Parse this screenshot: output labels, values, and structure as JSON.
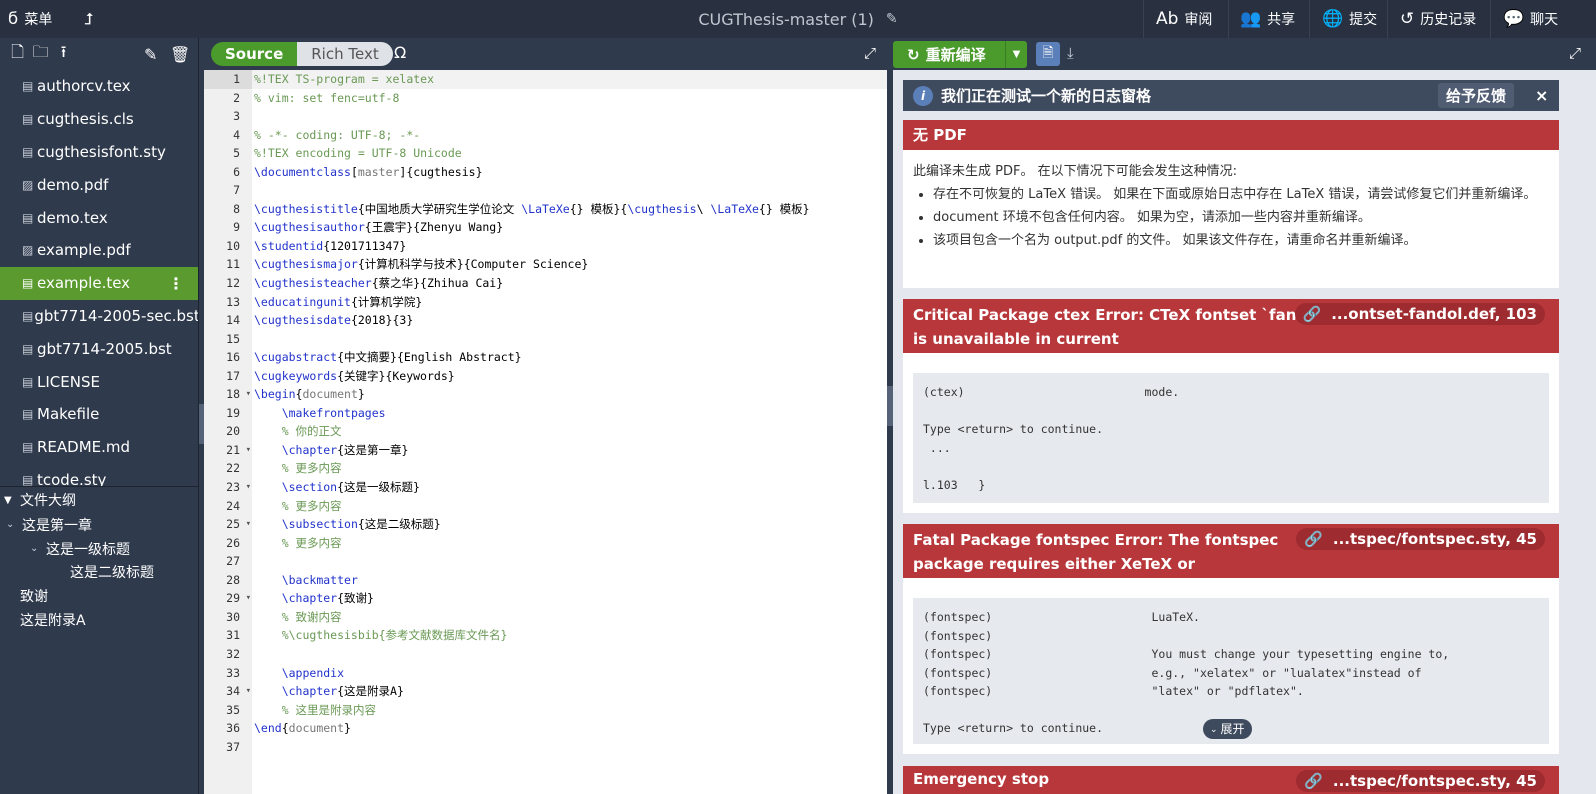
{
  "topbar": {
    "menu_label": "菜单",
    "project_title": "CUGThesis-master (1)",
    "review_label": "审阅",
    "share_label": "共享",
    "submit_label": "提交",
    "history_label": "历史记录",
    "chat_label": "聊天"
  },
  "files": [
    {
      "name": "authorcv.tex",
      "icon": "file-icon"
    },
    {
      "name": "cugthesis.cls",
      "icon": "file-icon"
    },
    {
      "name": "cugthesisfont.sty",
      "icon": "file-icon"
    },
    {
      "name": "demo.pdf",
      "icon": "image-icon"
    },
    {
      "name": "demo.tex",
      "icon": "file-icon"
    },
    {
      "name": "example.pdf",
      "icon": "image-icon"
    },
    {
      "name": "example.tex",
      "icon": "file-icon",
      "selected": true
    },
    {
      "name": "gbt7714-2005-sec.bst",
      "icon": "file-icon"
    },
    {
      "name": "gbt7714-2005.bst",
      "icon": "file-icon"
    },
    {
      "name": "LICENSE",
      "icon": "file-icon"
    },
    {
      "name": "Makefile",
      "icon": "file-icon"
    },
    {
      "name": "README.md",
      "icon": "file-icon"
    },
    {
      "name": "tcode.sty",
      "icon": "file-icon"
    }
  ],
  "outline": {
    "title": "文件大纲",
    "items": [
      {
        "label": "这是第一章",
        "level": 0,
        "toggle": true
      },
      {
        "label": "这是一级标题",
        "level": 1,
        "toggle": true
      },
      {
        "label": "这是二级标题",
        "level": 2,
        "toggle": false
      },
      {
        "label": "致谢",
        "level": 0,
        "toggle": false
      },
      {
        "label": "这是附录A",
        "level": 0,
        "toggle": false
      }
    ]
  },
  "editor": {
    "source_label": "Source",
    "richtext_label": "Rich Text",
    "omega_label": "Ω",
    "lines": [
      "%!TEX TS-program = xelatex",
      "% vim: set fenc=utf-8",
      "",
      "% -*- coding: UTF-8; -*-",
      "%!TEX encoding = UTF-8 Unicode",
      "\\documentclass[master]{cugthesis}",
      "",
      "\\cugthesistitle{中国地质大学研究生学位论文 \\LaTeXe{} 模板}{\\cugthesis\\ \\LaTeXe{} 模板}",
      "\\cugthesisauthor{王震宇}{Zhenyu Wang}",
      "\\studentid{1201711347}",
      "\\cugthesismajor{计算机科学与技术}{Computer Science}",
      "\\cugthesisteacher{蔡之华}{Zhihua Cai}",
      "\\educatingunit{计算机学院}",
      "\\cugthesisdate{2018}{3}",
      "",
      "\\cugabstract{中文摘要}{English Abstract}",
      "\\cugkeywords{关键字}{Keywords}",
      "\\begin{document}",
      "    \\makefrontpages",
      "    % 你的正文",
      "    \\chapter{这是第一章}",
      "    % 更多内容",
      "    \\section{这是一级标题}",
      "    % 更多内容",
      "    \\subsection{这是二级标题}",
      "    % 更多内容",
      "",
      "    \\backmatter",
      "    \\chapter{致谢}",
      "    % 致谢内容",
      "    %\\cugthesisbib{参考文献数据库文件名}",
      "",
      "    \\appendix",
      "    \\chapter{这是附录A}",
      "    % 这里是附录内容",
      "\\end{document}",
      ""
    ],
    "fold_lines": [
      18,
      21,
      23,
      25,
      29,
      34
    ]
  },
  "logs": {
    "recompile_label": "重新编译",
    "banner_text": "我们正在测试一个新的日志窗格",
    "feedback_label": "给予反馈",
    "close_label": "×",
    "nopdf": {
      "title": "无 PDF",
      "intro": "此编译未生成 PDF。 在以下情况下可能会发生这种情况:",
      "bullets": [
        "存在不可恢复的 LaTeX 错误。 如果在下面或原始日志中存在 LaTeX 错误，请尝试修复它们并重新编译。",
        "document 环境不包含任何内容。 如果为空，请添加一些内容并重新编译。",
        "该项目包含一个名为 output.pdf 的文件。 如果该文件存在，请重命名并重新编译。"
      ]
    },
    "errors": [
      {
        "title": "Critical Package ctex Error: CTeX fontset `fandol' is unavailable in current",
        "location": "...ontset-fandol.def, 103",
        "content": "(ctex)                          mode.\n\nType <return> to continue.\n ...\n\nl.103   }"
      },
      {
        "title": "Fatal Package fontspec Error: The fontspec package requires either XeTeX or",
        "location": "...tspec/fontspec.sty, 45",
        "content": "(fontspec)                       LuaTeX.\n(fontspec)\n(fontspec)                       You must change your typesetting engine to,\n(fontspec)                       e.g., \"xelatex\" or \"lualatex\"instead of\n(fontspec)                       \"latex\" or \"pdflatex\".\n\nType <return> to continue.",
        "expand_label": "展开"
      },
      {
        "title": "Emergency stop",
        "location": "...tspec/fontspec.sty, 45"
      }
    ]
  },
  "colors": {
    "topbar": "#293141",
    "sidebar": "#2f3a4c",
    "accent_green": "#4a9b2c",
    "error_red": "#b8373b"
  }
}
